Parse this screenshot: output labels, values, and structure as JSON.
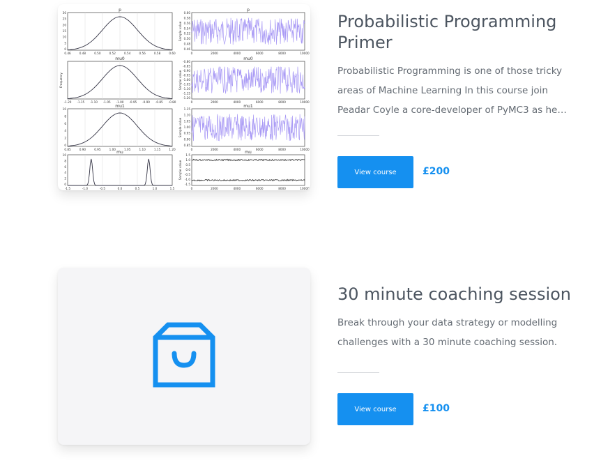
{
  "courses": [
    {
      "title": "Probabilistic Programming Primer",
      "description_lines": [
        "Probabilistic Programming is one of those tricky",
        "areas of Machine Learning In this course join",
        "Peadar Coyle a core-developer of PyMC3 as hel..."
      ],
      "button_label": "View course",
      "price": "£200",
      "image": {
        "type": "trace-plot",
        "panels": [
          {
            "density_title": "p",
            "trace_title": "p",
            "density_xticks": [
              "0.46",
              "0.48",
              "0.50",
              "0.52",
              "0.54",
              "0.56",
              "0.58",
              "0.60"
            ],
            "density_yticks": [
              "30",
              "25",
              "20",
              "15",
              "10",
              "5",
              "0"
            ],
            "trace_yticks": [
              "0.60",
              "0.58",
              "0.56",
              "0.54",
              "0.52",
              "0.50",
              "0.48",
              "0.46"
            ],
            "trace_ylabel": "Sample value"
          },
          {
            "density_title": "mu0",
            "trace_title": "mu0",
            "density_xticks": [
              "-1.20",
              "-1.15",
              "-1.10",
              "-1.05",
              "-1.00",
              "-0.95",
              "-0.90",
              "-0.85",
              "-0.80"
            ],
            "density_ylabel": "Frequency",
            "trace_yticks": [
              "-0.80",
              "-0.85",
              "-0.90",
              "-0.95",
              "-1.00",
              "-1.05",
              "-1.10",
              "-1.15",
              "-1.20"
            ],
            "trace_ylabel": "Sample value"
          },
          {
            "density_title": "mu1",
            "trace_title": "mu1",
            "density_xticks": [
              "0.85",
              "0.90",
              "0.95",
              "1.00",
              "1.05",
              "1.10",
              "1.15",
              "1.20"
            ],
            "density_yticks": [
              "10",
              "8",
              "6",
              "4",
              "2",
              "0"
            ],
            "trace_yticks": [
              "1.15",
              "1.10",
              "1.05",
              "1.00",
              "0.95",
              "0.90",
              "0.85"
            ],
            "trace_ylabel": "Sample value"
          },
          {
            "density_title": "mu",
            "trace_title": "mu",
            "density_xticks": [
              "-1.5",
              "-1.0",
              "-0.5",
              "0.0",
              "0.5",
              "1.0",
              "1.5"
            ],
            "density_yticks": [
              "10",
              "8",
              "6",
              "4",
              "2",
              "0"
            ],
            "trace_yticks": [
              "1.5",
              "1.0",
              "0.5",
              "0.0",
              "-0.5",
              "-1.0",
              "-1.5"
            ],
            "trace_ylabel": "Sample value"
          }
        ],
        "trace_xticks": [
          "0",
          "2000",
          "4000",
          "6000",
          "8000",
          "10000"
        ]
      }
    },
    {
      "title": "30 minute coaching session",
      "description_lines": [
        "Break through your data strategy or modelling",
        "challenges with a 30 minute coaching session."
      ],
      "button_label": "View course",
      "price": "£100",
      "image": {
        "icon": "shopping-bag-icon"
      }
    }
  ],
  "colors": {
    "accent": "#1590f0",
    "title": "#4c5560",
    "body_text": "#646b73",
    "trace_fill": "#a99af5"
  }
}
